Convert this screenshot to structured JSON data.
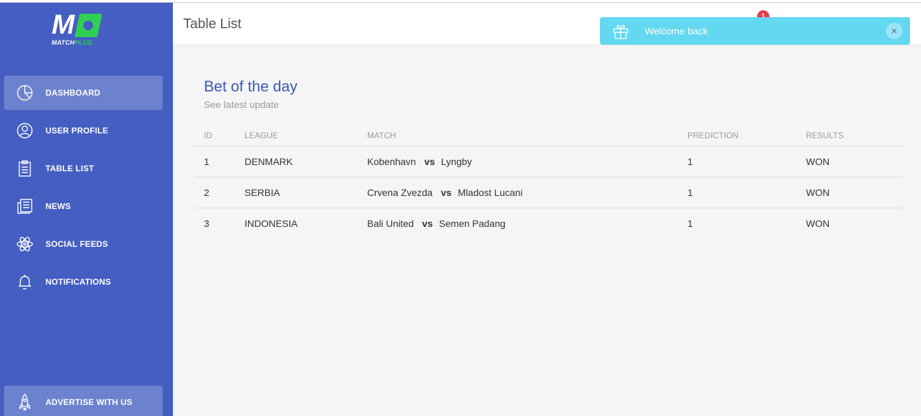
{
  "brand": {
    "logo_letter": "M",
    "wordmark_match": "MATCH",
    "wordmark_plug": "PLUG",
    "colors": {
      "sidebar": "#445fc1",
      "accent_green": "#2fcf54",
      "title_blue": "#3b58b8",
      "toast": "#63d8f1",
      "badge": "#e93c4a"
    }
  },
  "sidebar": {
    "items": [
      {
        "label": "DASHBOARD",
        "icon": "pie-chart-icon",
        "active": true
      },
      {
        "label": "USER PROFILE",
        "icon": "user-icon",
        "active": false
      },
      {
        "label": "TABLE LIST",
        "icon": "clipboard-icon",
        "active": false
      },
      {
        "label": "NEWS",
        "icon": "newspaper-icon",
        "active": false
      },
      {
        "label": "SOCIAL FEEDS",
        "icon": "atom-icon",
        "active": false
      },
      {
        "label": "NOTIFICATIONS",
        "icon": "bell-icon",
        "active": false
      }
    ],
    "advertise": {
      "label": "ADVERTISE WITH US",
      "icon": "rocket-icon"
    }
  },
  "header": {
    "title": "Table List",
    "notification_count": "1"
  },
  "toast": {
    "message": "Welcome back",
    "icon": "gift-icon",
    "close_label": "×"
  },
  "card": {
    "title": "Bet of the day",
    "subtitle": "See latest update",
    "columns": [
      "ID",
      "LEAGUE",
      "MATCH",
      "PREDICTION",
      "RESULTS"
    ],
    "vs_label": "vs",
    "rows": [
      {
        "id": "1",
        "league": "DENMARK",
        "home": "Kobenhavn",
        "away": "Lyngby",
        "prediction": "1",
        "result": "WON"
      },
      {
        "id": "2",
        "league": "SERBIA",
        "home": "Crvena Zvezda",
        "away": "Mladost Lucani",
        "prediction": "1",
        "result": "WON"
      },
      {
        "id": "3",
        "league": "INDONESIA",
        "home": "Bali United",
        "away": "Semen Padang",
        "prediction": "1",
        "result": "WON"
      }
    ]
  }
}
